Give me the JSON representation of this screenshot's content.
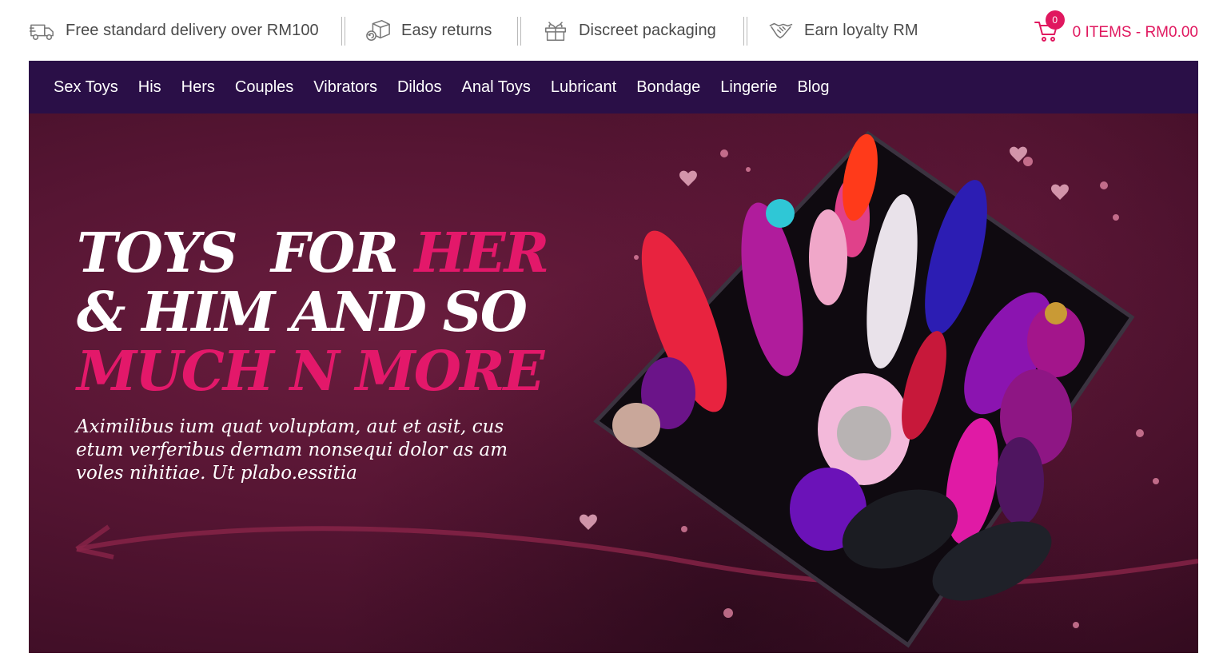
{
  "perks": [
    {
      "label": "Free standard delivery over RM100",
      "icon": "delivery-truck-icon"
    },
    {
      "label": "Easy returns",
      "icon": "returns-box-icon"
    },
    {
      "label": "Discreet packaging",
      "icon": "gift-box-icon"
    },
    {
      "label": "Earn loyalty RM",
      "icon": "handshake-icon"
    }
  ],
  "cart": {
    "count": "0",
    "summary": "0 ITEMS - RM0.00",
    "icon": "cart-icon"
  },
  "nav": [
    "Sex Toys",
    "His",
    "Hers",
    "Couples",
    "Vibrators",
    "Dildos",
    "Anal Toys",
    "Lubricant",
    "Bondage",
    "Lingerie",
    "Blog"
  ],
  "hero": {
    "line1_white": "TOYS  FOR ",
    "line1_pink": "HER",
    "line2_white": "& HIM AND SO",
    "line3_pink": "MUCH N MORE",
    "subtitle": "Aximilibus ium quat voluptam, aut et asit, cus etum verferibus dernam nonsequi dolor as am voles nihitiae. Ut plabo.essitia"
  },
  "colors": {
    "accent": "#e0185f",
    "nav_bg": "#2a0f47",
    "hero_bg": "#561533",
    "text": "#4a4a4a"
  }
}
